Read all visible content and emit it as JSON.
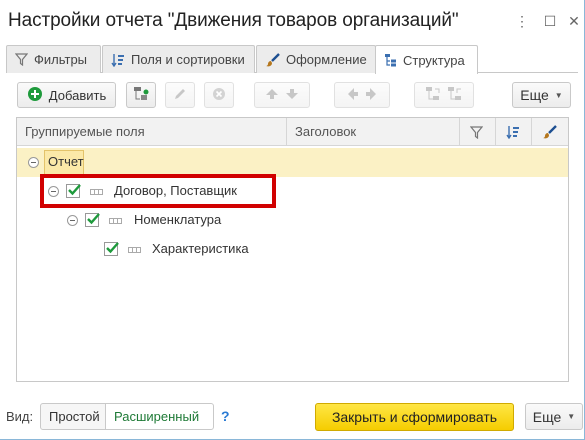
{
  "window": {
    "title": "Настройки отчета \"Движения товаров организаций\"",
    "controls": {
      "menu": "⋮",
      "maximize": "☐",
      "close": "✕"
    }
  },
  "tabs": [
    {
      "label": "Фильтры",
      "icon": "filter-icon"
    },
    {
      "label": "Поля и сортировки",
      "icon": "sort-fields-icon"
    },
    {
      "label": "Оформление",
      "icon": "brush-icon"
    },
    {
      "label": "Структура",
      "icon": "structure-icon",
      "active": true
    }
  ],
  "toolbar": {
    "add_label": "Добавить",
    "more_label": "Еще"
  },
  "table": {
    "columns": [
      "Группируемые поля",
      "Заголовок"
    ],
    "header_icons": [
      "filter-icon",
      "sort-fields-icon",
      "brush-icon"
    ],
    "rows": [
      {
        "label": "Отчет",
        "level": 0,
        "checked": false,
        "selected": true
      },
      {
        "label": "Договор, Поставщик",
        "level": 1,
        "checked": true
      },
      {
        "label": "Номенклатура",
        "level": 2,
        "checked": true
      },
      {
        "label": "Характеристика",
        "level": 3,
        "checked": true
      }
    ]
  },
  "footer": {
    "view_label": "Вид:",
    "view_simple": "Простой",
    "view_extended": "Расширенный",
    "help": "?",
    "primary_label": "Закрыть и сформировать",
    "more_label": "Еще"
  },
  "colors": {
    "accent_green": "#1e9a3c",
    "highlight_yellow": "#fbf1c5",
    "primary_yellow": "#f5cd00",
    "annotation_red": "#d10000",
    "help_blue": "#2a7bd4"
  }
}
